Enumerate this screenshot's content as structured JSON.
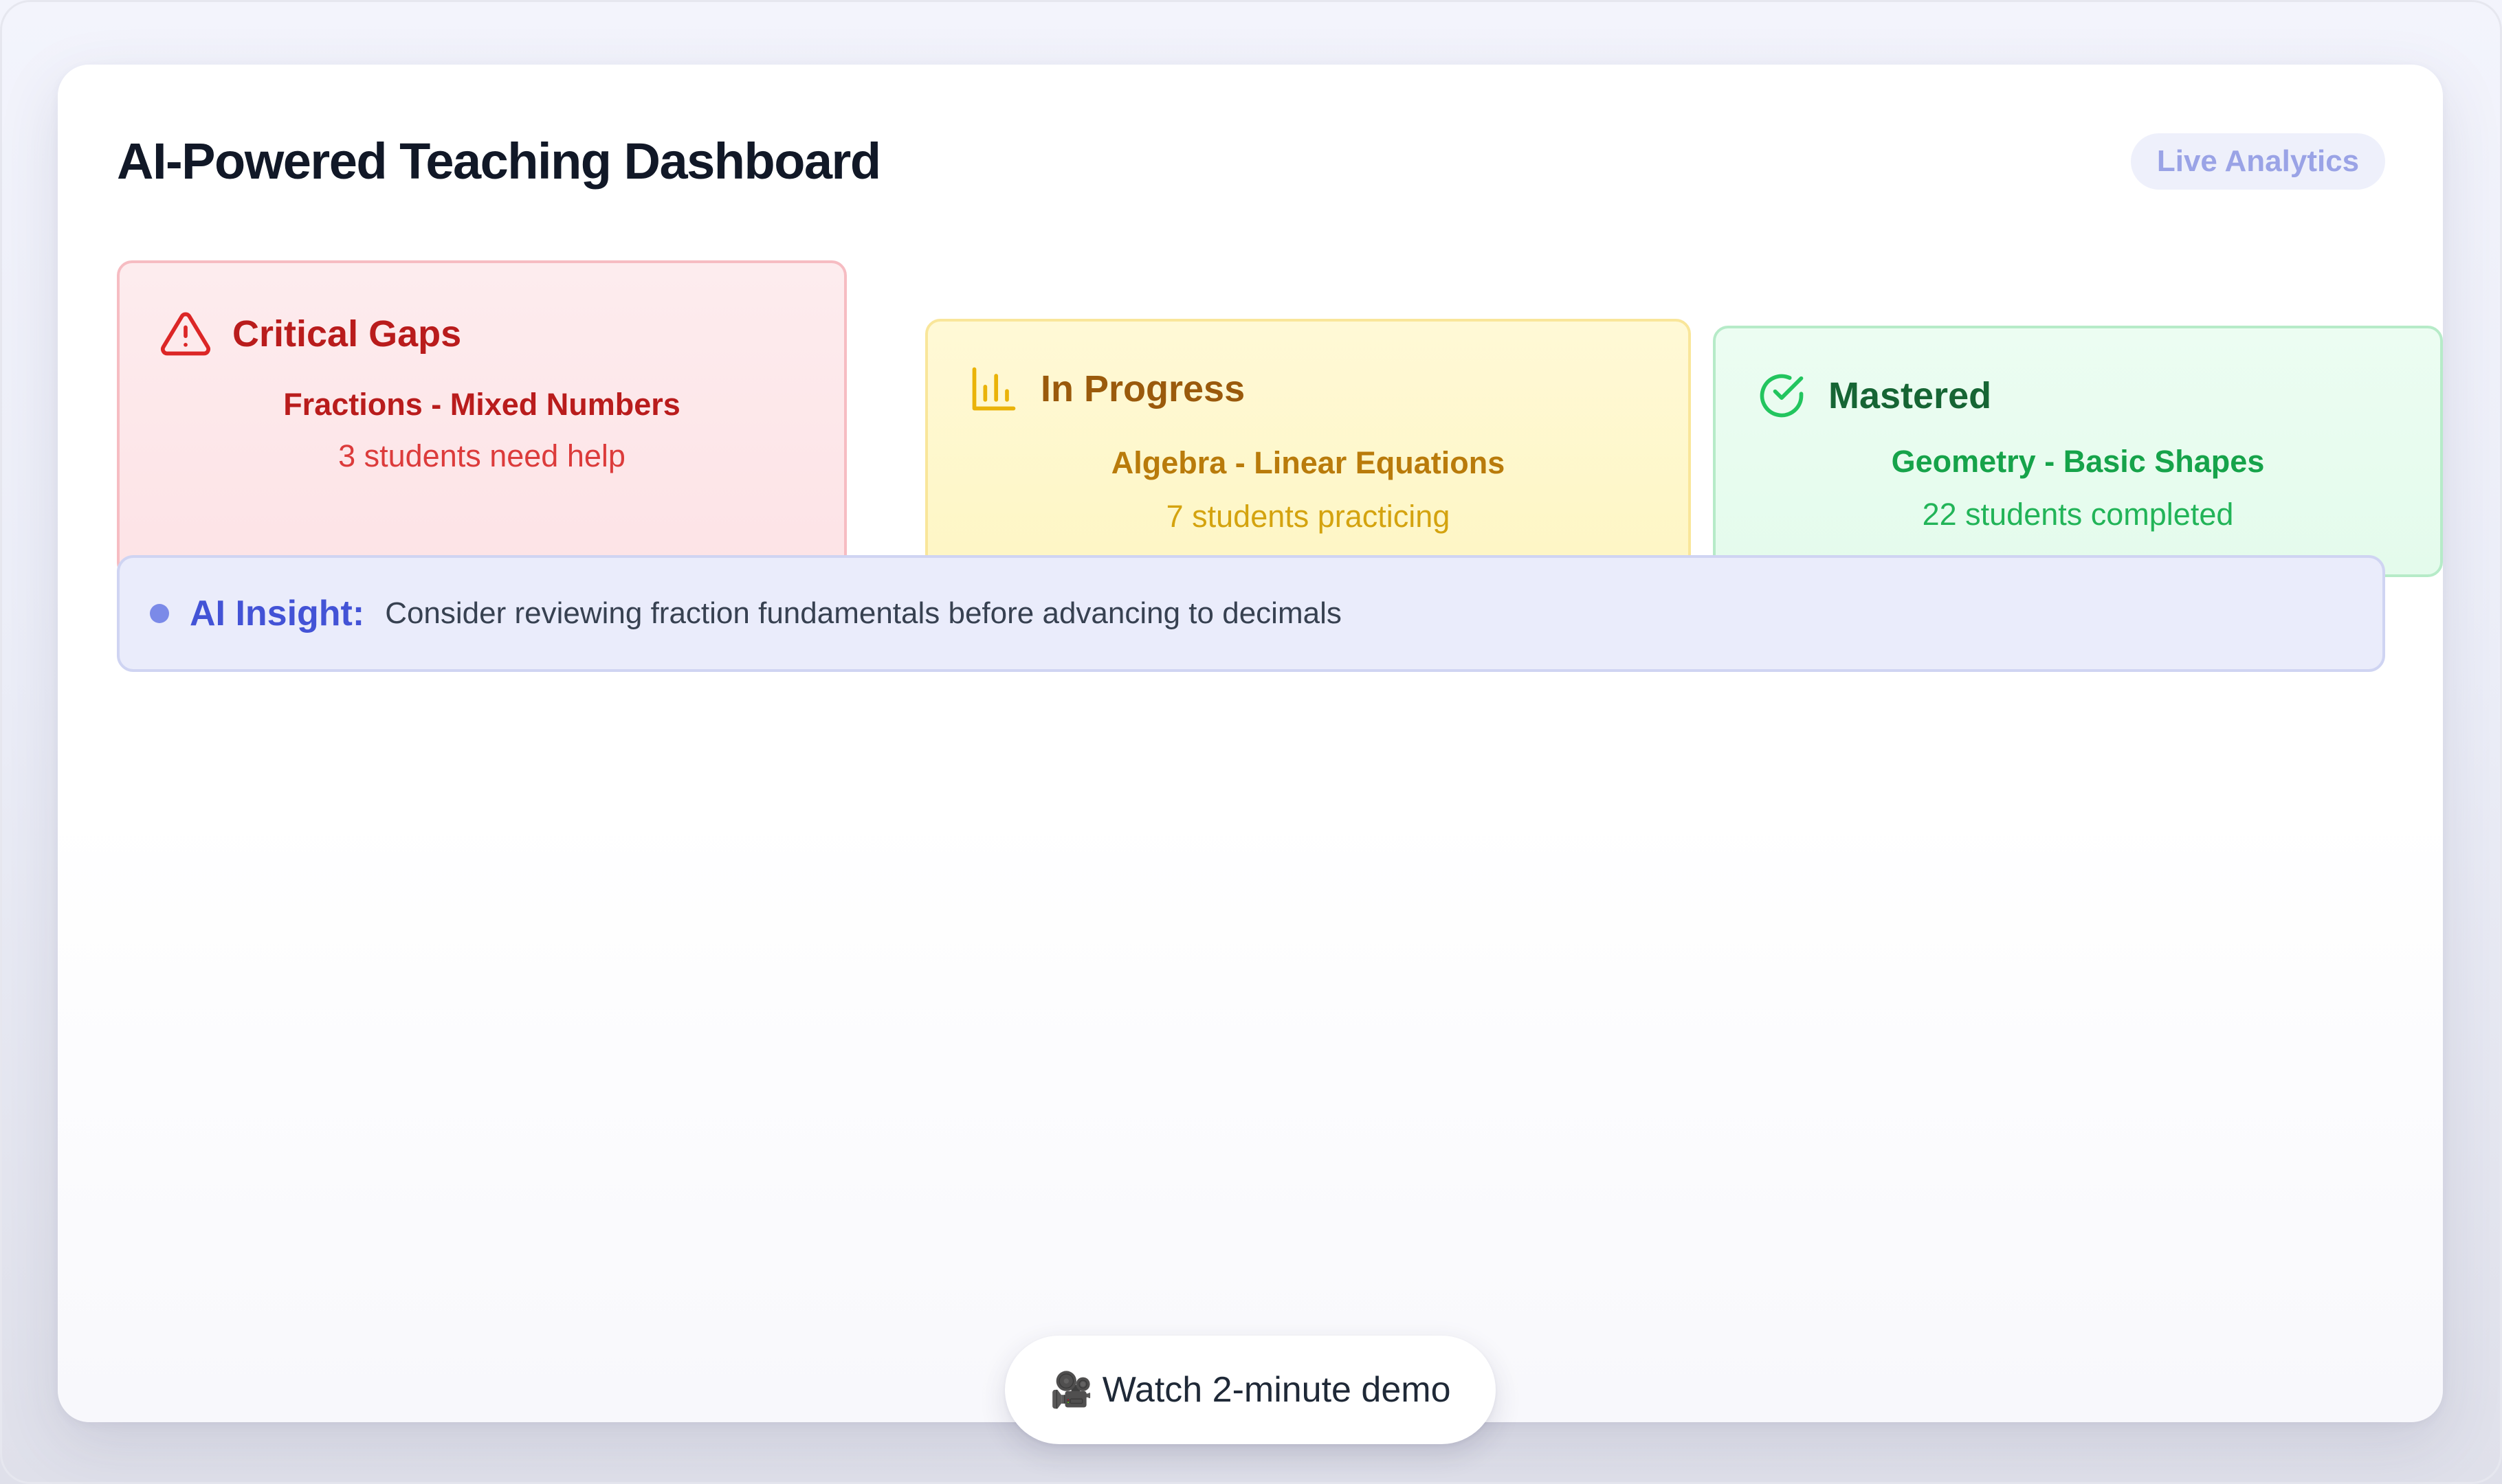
{
  "dashboard": {
    "title": "AI-Powered Teaching Dashboard",
    "badge": "Live Analytics"
  },
  "status_cards": [
    {
      "icon": "warning-triangle-icon",
      "label": "Critical Gaps",
      "topic": "Fractions - Mixed Numbers",
      "detail": "3 students need help",
      "color": "#b91c1c"
    },
    {
      "icon": "bar-chart-icon",
      "label": "In Progress",
      "topic": "Algebra - Linear Equations",
      "detail": "7 students practicing",
      "color": "#ca8a04"
    },
    {
      "icon": "check-circle-icon",
      "label": "Mastered",
      "topic": "Geometry - Basic Shapes",
      "detail": "22 students completed",
      "color": "#16a34a"
    }
  ],
  "insight": {
    "label": "AI Insight:",
    "text": "Consider reviewing fraction fundamentals before advancing to decimals",
    "accent": "#4353d6"
  },
  "demo_button": {
    "icon": "movie-camera-icon",
    "label": "Watch 2-minute demo"
  }
}
